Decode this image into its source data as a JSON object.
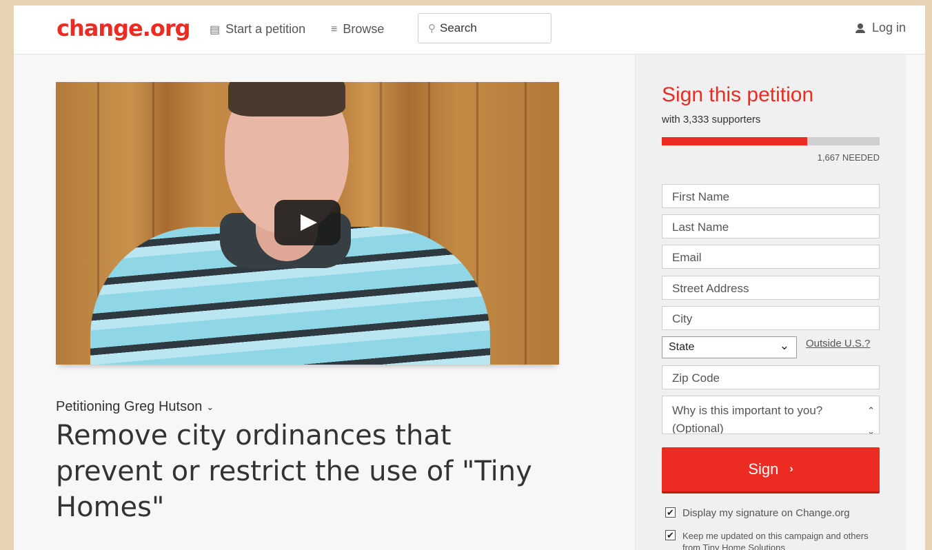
{
  "header": {
    "logo": "change.org",
    "nav": {
      "start_petition": "Start a petition",
      "browse": "Browse"
    },
    "search_label": "Search",
    "login": "Log in"
  },
  "main": {
    "petitioning": "Petitioning Greg Hutson",
    "title": "Remove city ordinances that prevent or restrict the use of \"Tiny Homes\""
  },
  "sidebar": {
    "heading": "Sign this petition",
    "supporters": "with 3,333 supporters",
    "progress": 0.667,
    "needed": "1,667 NEEDED",
    "fields": {
      "first_name": "First Name",
      "last_name": "Last Name",
      "email": "Email",
      "street": "Street Address",
      "city": "City",
      "state": "State",
      "outside_us": "Outside U.S.?",
      "zip": "Zip Code",
      "reason": "Why is this important to you? (Optional)"
    },
    "sign_button": "Sign",
    "checkboxes": {
      "display_signature": "Display my signature on Change.org",
      "keep_updated": "Keep me updated on this campaign and others from Tiny Home Solutions"
    }
  },
  "colors": {
    "brand_red": "#ec2c22"
  }
}
